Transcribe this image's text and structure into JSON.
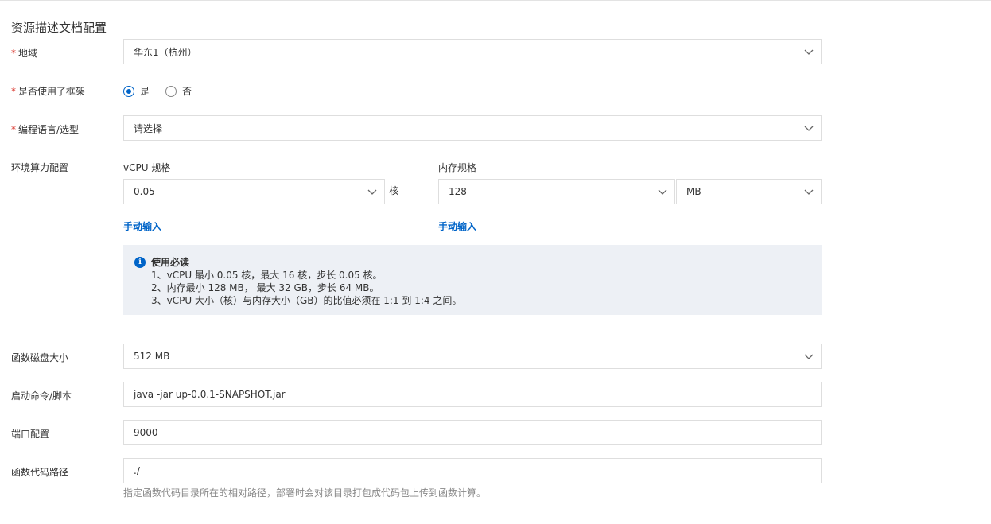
{
  "section_title": "资源描述文档配置",
  "required_mark": "*",
  "region": {
    "label": "地域",
    "value": "华东1（杭州）"
  },
  "framework": {
    "label": "是否使用了框架",
    "options": [
      {
        "label": "是",
        "checked": true
      },
      {
        "label": "否",
        "checked": false
      }
    ]
  },
  "language": {
    "label": "编程语言/选型",
    "placeholder": "请选择"
  },
  "compute": {
    "label": "环境算力配置",
    "vcpu": {
      "label": "vCPU 规格",
      "value": "0.05",
      "unit": "核",
      "manual_link": "手动输入"
    },
    "memory": {
      "label": "内存规格",
      "value": "128",
      "unit_value": "MB",
      "manual_link": "手动输入"
    }
  },
  "notice": {
    "title": "使用必读",
    "lines": [
      "1、vCPU 最小 0.05 核，最大 16 核，步长 0.05 核。",
      "2、内存最小 128 MB， 最大 32 GB，步长 64 MB。",
      "3、vCPU 大小（核）与内存大小（GB）的比值必须在 1:1 到 1:4 之间。"
    ]
  },
  "disk": {
    "label": "函数磁盘大小",
    "value": "512 MB"
  },
  "command": {
    "label": "启动命令/脚本",
    "value": "java -jar up-0.0.1-SNAPSHOT.jar"
  },
  "port": {
    "label": "端口配置",
    "value": "9000"
  },
  "code_path": {
    "label": "函数代码路径",
    "value": "./",
    "hint": "指定函数代码目录所在的相对路径，部署时会对该目录打包成代码包上传到函数计算。"
  },
  "icons": {
    "dropdown": "chevron-down-icon",
    "info": "info-icon"
  },
  "colors": {
    "accent": "#0064c8",
    "required": "#d93026",
    "notice_bg": "#edf0f5",
    "border": "#dedede"
  }
}
